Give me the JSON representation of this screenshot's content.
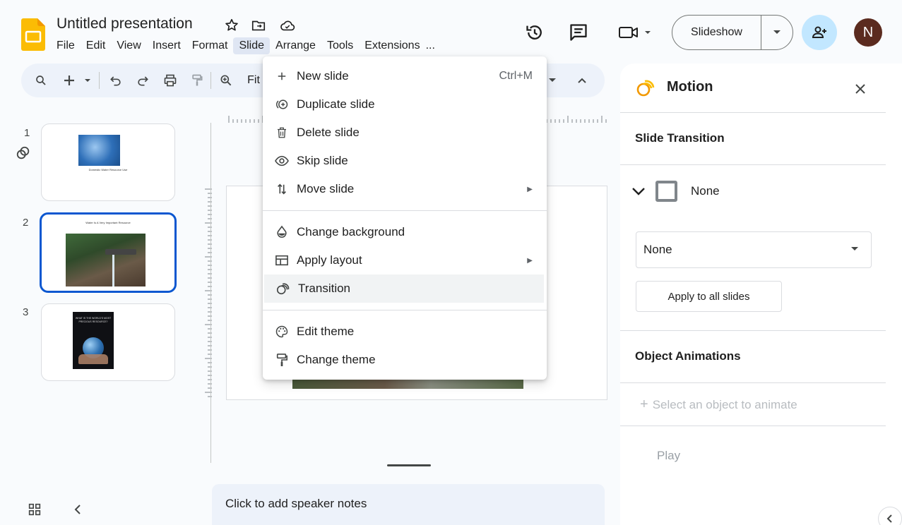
{
  "header": {
    "title": "Untitled presentation",
    "menus": [
      "File",
      "Edit",
      "View",
      "Insert",
      "Format",
      "Slide",
      "Arrange",
      "Tools",
      "Extensions",
      "..."
    ],
    "active_menu": "Slide",
    "slideshow_label": "Slideshow",
    "avatar_initial": "N"
  },
  "toolbar": {
    "zoom_label": "Fit"
  },
  "filmstrip": {
    "slides": [
      {
        "number": "1",
        "caption": "Domestic Water Resource Use"
      },
      {
        "number": "2",
        "caption": "Water Is A Very Important Resource"
      },
      {
        "number": "3",
        "caption": "WHAT IS THE WORLD'S MOST PRECIOUS RESOURCE?"
      }
    ],
    "selected": "2"
  },
  "editor": {
    "notes_placeholder": "Click to add speaker notes"
  },
  "slide_menu": {
    "items": [
      {
        "label": "New slide",
        "icon": "plus-icon",
        "shortcut": "Ctrl+M"
      },
      {
        "label": "Duplicate slide",
        "icon": "duplicate-icon"
      },
      {
        "label": "Delete slide",
        "icon": "trash-icon"
      },
      {
        "label": "Skip slide",
        "icon": "eye-icon"
      },
      {
        "label": "Move slide",
        "icon": "move-icon",
        "submenu": true
      },
      {
        "label": "Change background",
        "icon": "droplet-icon"
      },
      {
        "label": "Apply layout",
        "icon": "layout-icon",
        "submenu": true
      },
      {
        "label": "Transition",
        "icon": "transition-icon",
        "highlighted": true
      },
      {
        "label": "Edit theme",
        "icon": "palette-icon"
      },
      {
        "label": "Change theme",
        "icon": "paint-roller-icon"
      }
    ]
  },
  "motion_panel": {
    "title": "Motion",
    "slide_transition_heading": "Slide Transition",
    "current_transition": "None",
    "transition_select_value": "None",
    "apply_all_label": "Apply to all slides",
    "object_animations_heading": "Object Animations",
    "select_object_label": "Select an object to animate",
    "play_label": "Play"
  },
  "colors": {
    "accent_blue": "#0b57d0",
    "share_bg": "#c2e7ff",
    "avatar_bg": "#5b2b1f",
    "logo_yellow": "#fbbc04"
  }
}
